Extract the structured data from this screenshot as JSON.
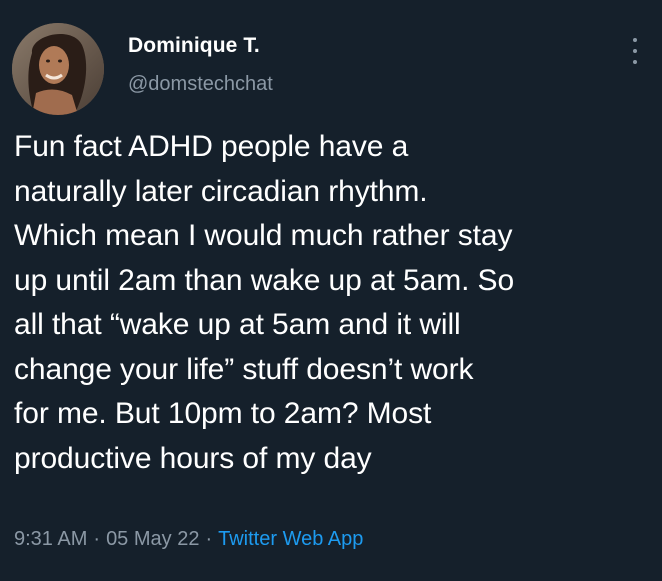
{
  "author": {
    "display_name": "Dominique T.",
    "handle": "@domstechchat"
  },
  "tweet": {
    "lines": [
      "Fun fact ADHD people have a",
      "naturally later circadian rhythm.",
      "Which mean I would much rather stay",
      "up until 2am than wake up at 5am. So",
      "all that “wake up at 5am and it will",
      "change your life” stuff doesn’t work",
      "for me. But 10pm to 2am? Most",
      "productive hours of my day"
    ],
    "time": "9:31 AM",
    "date": "05 May 22",
    "source": "Twitter Web App",
    "separator": "·"
  },
  "icons": {
    "more": "more-vertical-icon",
    "avatar": "profile-photo"
  },
  "colors": {
    "background": "#15202b",
    "text": "#ffffff",
    "secondary_text": "#8b98a5",
    "link": "#1d9bf0"
  }
}
